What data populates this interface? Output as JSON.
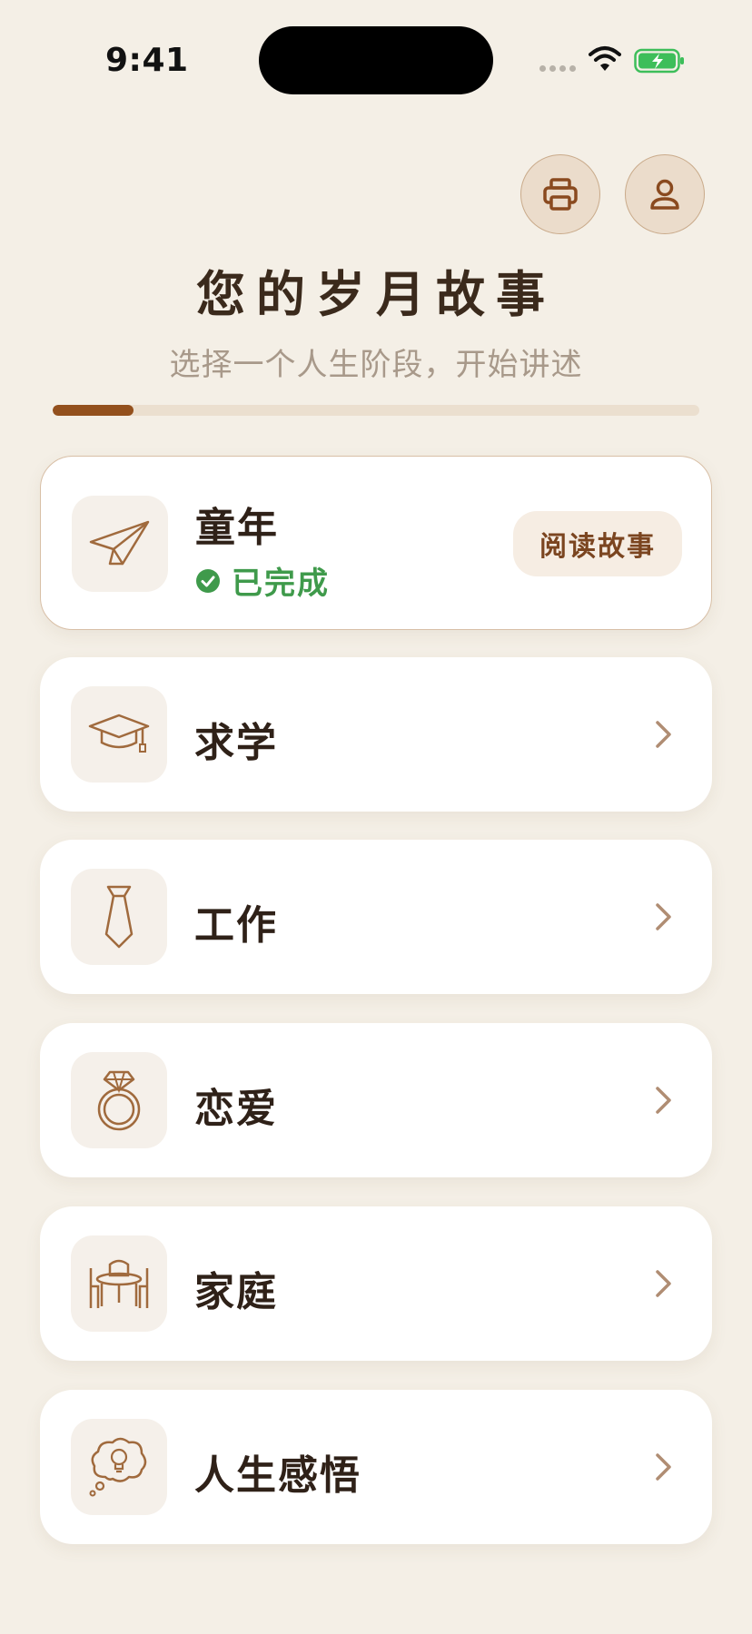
{
  "status_bar": {
    "time": "9:41"
  },
  "header": {
    "print_icon": "printer-icon",
    "profile_icon": "user-icon",
    "title": "您的岁月故事",
    "subtitle": "选择一个人生阶段，开始讲述",
    "progress": 0.125
  },
  "stages": [
    {
      "title": "童年",
      "icon": "paper-plane-icon",
      "status": "已完成",
      "action_label": "阅读故事",
      "completed": true
    },
    {
      "title": "求学",
      "icon": "graduation-cap-icon",
      "completed": false
    },
    {
      "title": "工作",
      "icon": "necktie-icon",
      "completed": false
    },
    {
      "title": "恋爱",
      "icon": "ring-icon",
      "completed": false
    },
    {
      "title": "家庭",
      "icon": "dining-table-icon",
      "completed": false
    },
    {
      "title": "人生感悟",
      "icon": "thought-bulb-icon",
      "completed": false
    }
  ],
  "colors": {
    "background": "#F4EFE6",
    "accent": "#93501D",
    "success": "#3F9A4B",
    "icon_stroke": "#A06A3D"
  }
}
